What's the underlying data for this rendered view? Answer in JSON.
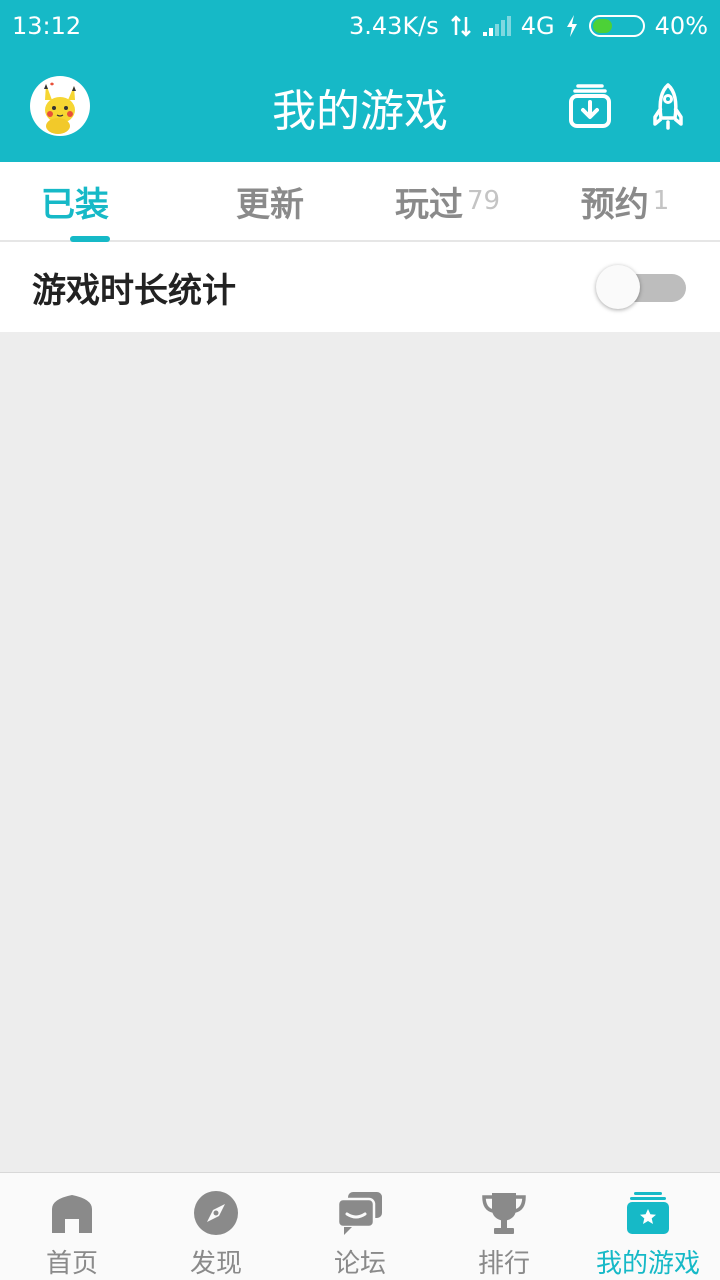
{
  "status_bar": {
    "time": "13:12",
    "net_speed": "3.43K/s",
    "network": "4G",
    "battery": "40%",
    "battery_level": 0.4
  },
  "app_bar": {
    "title": "我的游戏",
    "avatar_icon": "pikachu-avatar",
    "download_icon": "download-tray-icon",
    "rocket_icon": "rocket-icon"
  },
  "tabs": [
    {
      "label": "已装",
      "count": "",
      "active": true
    },
    {
      "label": "更新",
      "count": "",
      "active": false
    },
    {
      "label": "玩过",
      "count": "79",
      "active": false
    },
    {
      "label": "预约",
      "count": "1",
      "active": false
    }
  ],
  "stats": {
    "label": "游戏时长统计",
    "enabled": false
  },
  "bottom_nav": [
    {
      "label": "首页",
      "icon": "home-icon",
      "active": false
    },
    {
      "label": "发现",
      "icon": "compass-icon",
      "active": false
    },
    {
      "label": "论坛",
      "icon": "forum-icon",
      "active": false
    },
    {
      "label": "排行",
      "icon": "trophy-icon",
      "active": false
    },
    {
      "label": "我的游戏",
      "icon": "my-games-icon",
      "active": true
    }
  ],
  "colors": {
    "accent": "#16b9c7",
    "inactive": "#8a8a8a",
    "background": "#ededed"
  }
}
